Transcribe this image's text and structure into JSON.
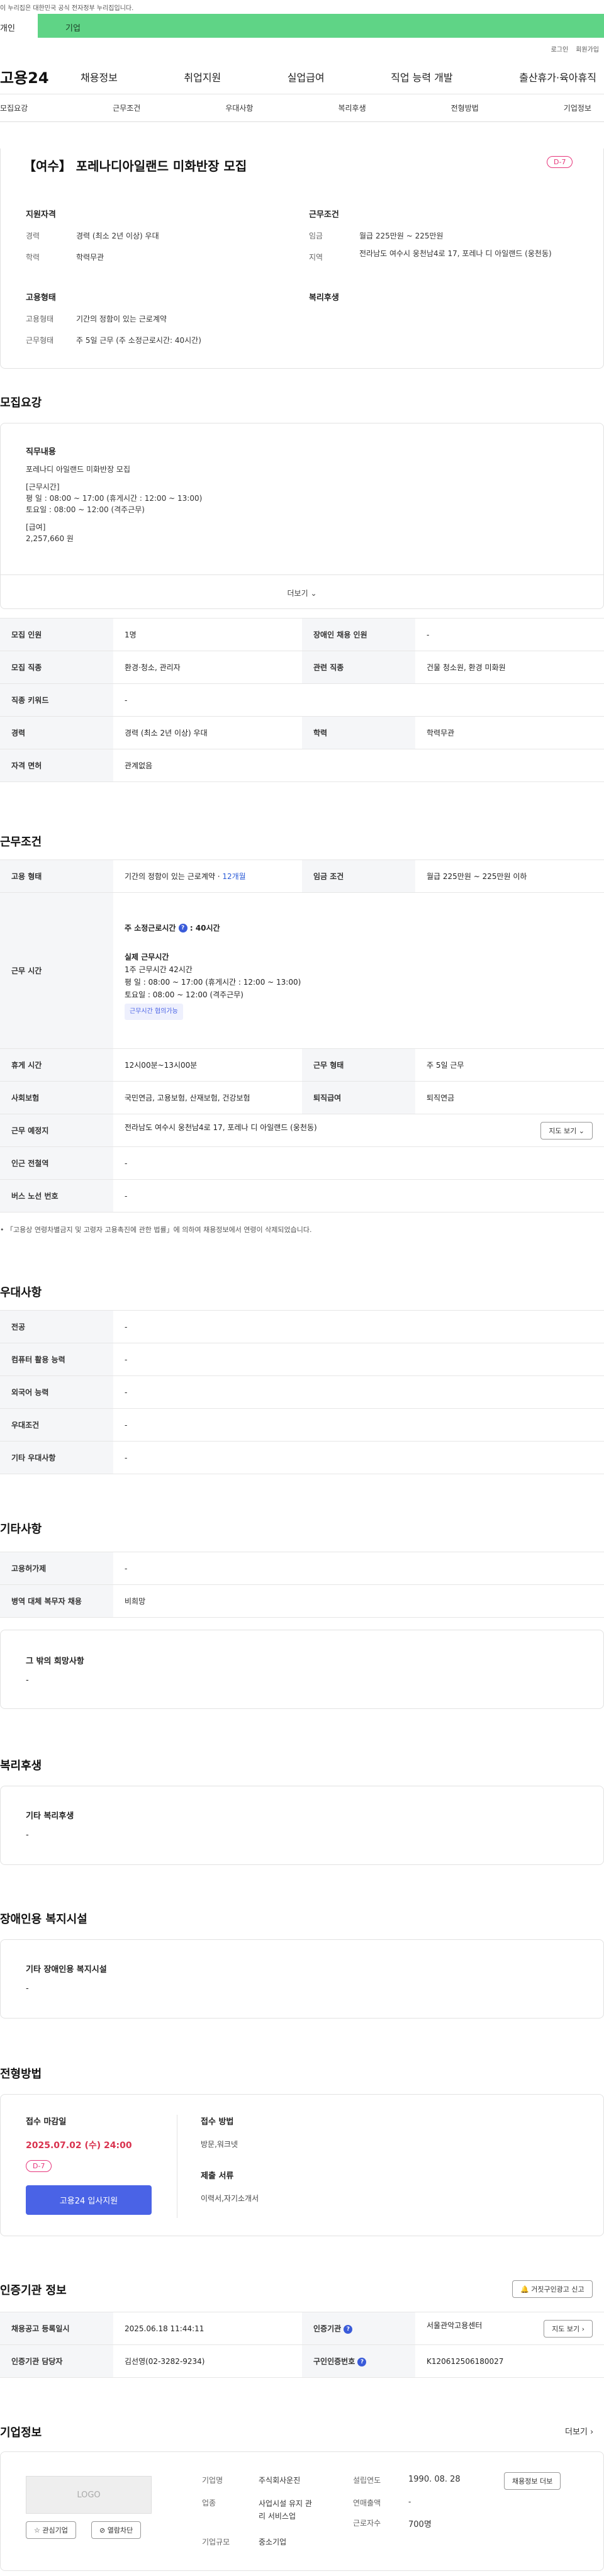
{
  "topbar": {
    "notice": "이 누리집은 대한민국 공식 전자정부 누리집입니다."
  },
  "usertabs": {
    "personal": "개인",
    "company": "기업"
  },
  "util": {
    "login": "로그인",
    "join": "회원가입"
  },
  "gnb": {
    "logo": "고용24",
    "menu": [
      "채용정보",
      "취업지원",
      "실업급여",
      "직업 능력 개발",
      "출산휴가·육아휴직"
    ]
  },
  "anchor": [
    "모집요강",
    "근무조건",
    "우대사항",
    "복리후생",
    "전형방법",
    "기업정보"
  ],
  "summary": {
    "title": "【여수】 포레나디아일랜드 미화반장 모집",
    "dday": "D-7",
    "qual_title": "지원자격",
    "qual": [
      {
        "k": "경력",
        "v": "경력 (최소 2년 이상) 우대"
      },
      {
        "k": "학력",
        "v": "학력무관"
      }
    ],
    "work_title": "근무조건",
    "work": [
      {
        "k": "임금",
        "v": "월급 225만원 ~ 225만원"
      },
      {
        "k": "지역",
        "v": "전라남도 여수시 웅천남4로 17, 포레나 디 아일랜드 (웅천동)"
      }
    ],
    "emp_title": "고용형태",
    "emp": [
      {
        "k": "고용형태",
        "v": "기간의 정함이 있는 근로계약"
      },
      {
        "k": "근무형태",
        "v": "주 5일 근무 (주 소정근로시간: 40시간)"
      }
    ],
    "welfare_title": "복리후생"
  },
  "recruit": {
    "title": "모집요강",
    "duty_title": "직무내용",
    "duty_lines": [
      "포레나디 아일랜드 미화반장 모집",
      "",
      "[근무시간]",
      "평    일 : 08:00 ~ 17:00 (휴게시간 : 12:00 ~ 13:00)",
      "토요일 : 08:00 ~ 12:00 (격주근무)",
      "",
      "[급여]",
      "2,257,660 원"
    ],
    "more": "더보기",
    "rows": [
      [
        "모집 인원",
        "1명",
        "장애인 채용 인원",
        "-"
      ],
      [
        "모집 직종",
        "환경·청소, 관리자",
        "관련 직종",
        "건물 청소원, 환경 미화원"
      ],
      [
        "직종 키워드",
        "-",
        "",
        ""
      ],
      [
        "경력",
        "경력 (최소 2년 이상) 우대",
        "학력",
        "학력무관"
      ],
      [
        "자격 면허",
        "관계없음",
        "",
        ""
      ]
    ]
  },
  "workcond": {
    "title": "근무조건",
    "emp_type_k": "고용 형태",
    "emp_type_v": "기간의 정함이 있는 근로계약 · ",
    "emp_type_months": "12개월",
    "wage_k": "임금 조건",
    "wage_v": "월급 225만원 ~ 225만원 이하",
    "hours_k": "근무 시간",
    "hours_weekly": "주 소정근로시간",
    "hours_weekly_val": ": 40시간",
    "hours_real_title": "실제 근무시간",
    "hours_lines": [
      "1주 근무시간 42시간",
      "평    일 : 08:00 ~ 17:00 (휴게시간 : 12:00 ~ 13:00)",
      "토요일 : 08:00 ~ 12:00 (격주근무)"
    ],
    "hours_tag": "근무시간 협의가능",
    "rows": [
      [
        "휴게 시간",
        "12시00분~13시00분",
        "근무 형태",
        "주 5일 근무"
      ],
      [
        "사회보험",
        "국민연금, 고용보험, 산재보험, 건강보험",
        "퇴직급여",
        "퇴직연금"
      ]
    ],
    "place_k": "근무 예정지",
    "place_v": "전라남도 여수시 웅천남4로 17, 포레나 디 아일랜드 (웅천동)",
    "map_btn": "지도 보기",
    "station_k": "인근 전철역",
    "station_v": "-",
    "bus_k": "버스 노선 번호",
    "bus_v": "-",
    "footnote": "「고용상 연령차별금지 및 고령자 고용촉진에 관한 법률」에 의하여 채용정보에서 연령이 삭제되었습니다."
  },
  "pref": {
    "title": "우대사항",
    "rows": [
      [
        "전공",
        "-"
      ],
      [
        "컴퓨터 활용 능력",
        "-"
      ],
      [
        "외국어 능력",
        "-"
      ],
      [
        "우대조건",
        "-"
      ],
      [
        "기타 우대사항",
        "-"
      ]
    ]
  },
  "etc": {
    "title": "기타사항",
    "rows": [
      [
        "고용허가제",
        "-"
      ],
      [
        "병역 대체 복무자 채용",
        "비희망"
      ]
    ],
    "box_title": "그 밖의 희망사항",
    "box_val": "-"
  },
  "welfare": {
    "title": "복리후생",
    "box_title": "기타 복리후생",
    "box_val": "-"
  },
  "disability": {
    "title": "장애인용 복지시설",
    "box_title": "기타 장애인용 복지시설",
    "box_val": "-"
  },
  "process": {
    "title": "전형방법",
    "deadline_title": "접수 마감일",
    "deadline": "2025.07.02 (수) 24:00",
    "dday": "D-7",
    "apply_btn": "고용24 입사지원",
    "method_title": "접수 방법",
    "method": "방문,워크넷",
    "docs_title": "제출 서류",
    "docs": "이력서,자기소개서"
  },
  "agency": {
    "title": "인증기관 정보",
    "report_btn": "거짓구인광고 신고",
    "reg_k": "채용공고 등록일시",
    "reg_v": "2025.06.18 11:44:11",
    "org_k": "인증기관",
    "org_v": "서울관악고용센터",
    "map_btn": "지도 보기",
    "mgr_k": "인증기관 담당자",
    "mgr_v": "김선영(02-3282-9234)",
    "no_k": "구인인증번호",
    "no_v": "K120612506180027"
  },
  "company": {
    "title": "기업정보",
    "more": "더보기",
    "logo": "LOGO",
    "fav_btn": "관심기업",
    "block_btn": "열람차단",
    "name_k": "기업명",
    "name_v": "주식회사운진",
    "ind_k": "업종",
    "ind_v1": "사업시설 유지 관",
    "ind_v2": "리 서비스업",
    "size_k": "기업규모",
    "size_v": "중소기업",
    "est_k": "설립연도",
    "est_v": "1990. 08. 28",
    "sales_k": "연매출액",
    "sales_v": "-",
    "emp_k": "근로자수",
    "emp_v": "700명",
    "jobs_btn": "채용정보 더보"
  }
}
